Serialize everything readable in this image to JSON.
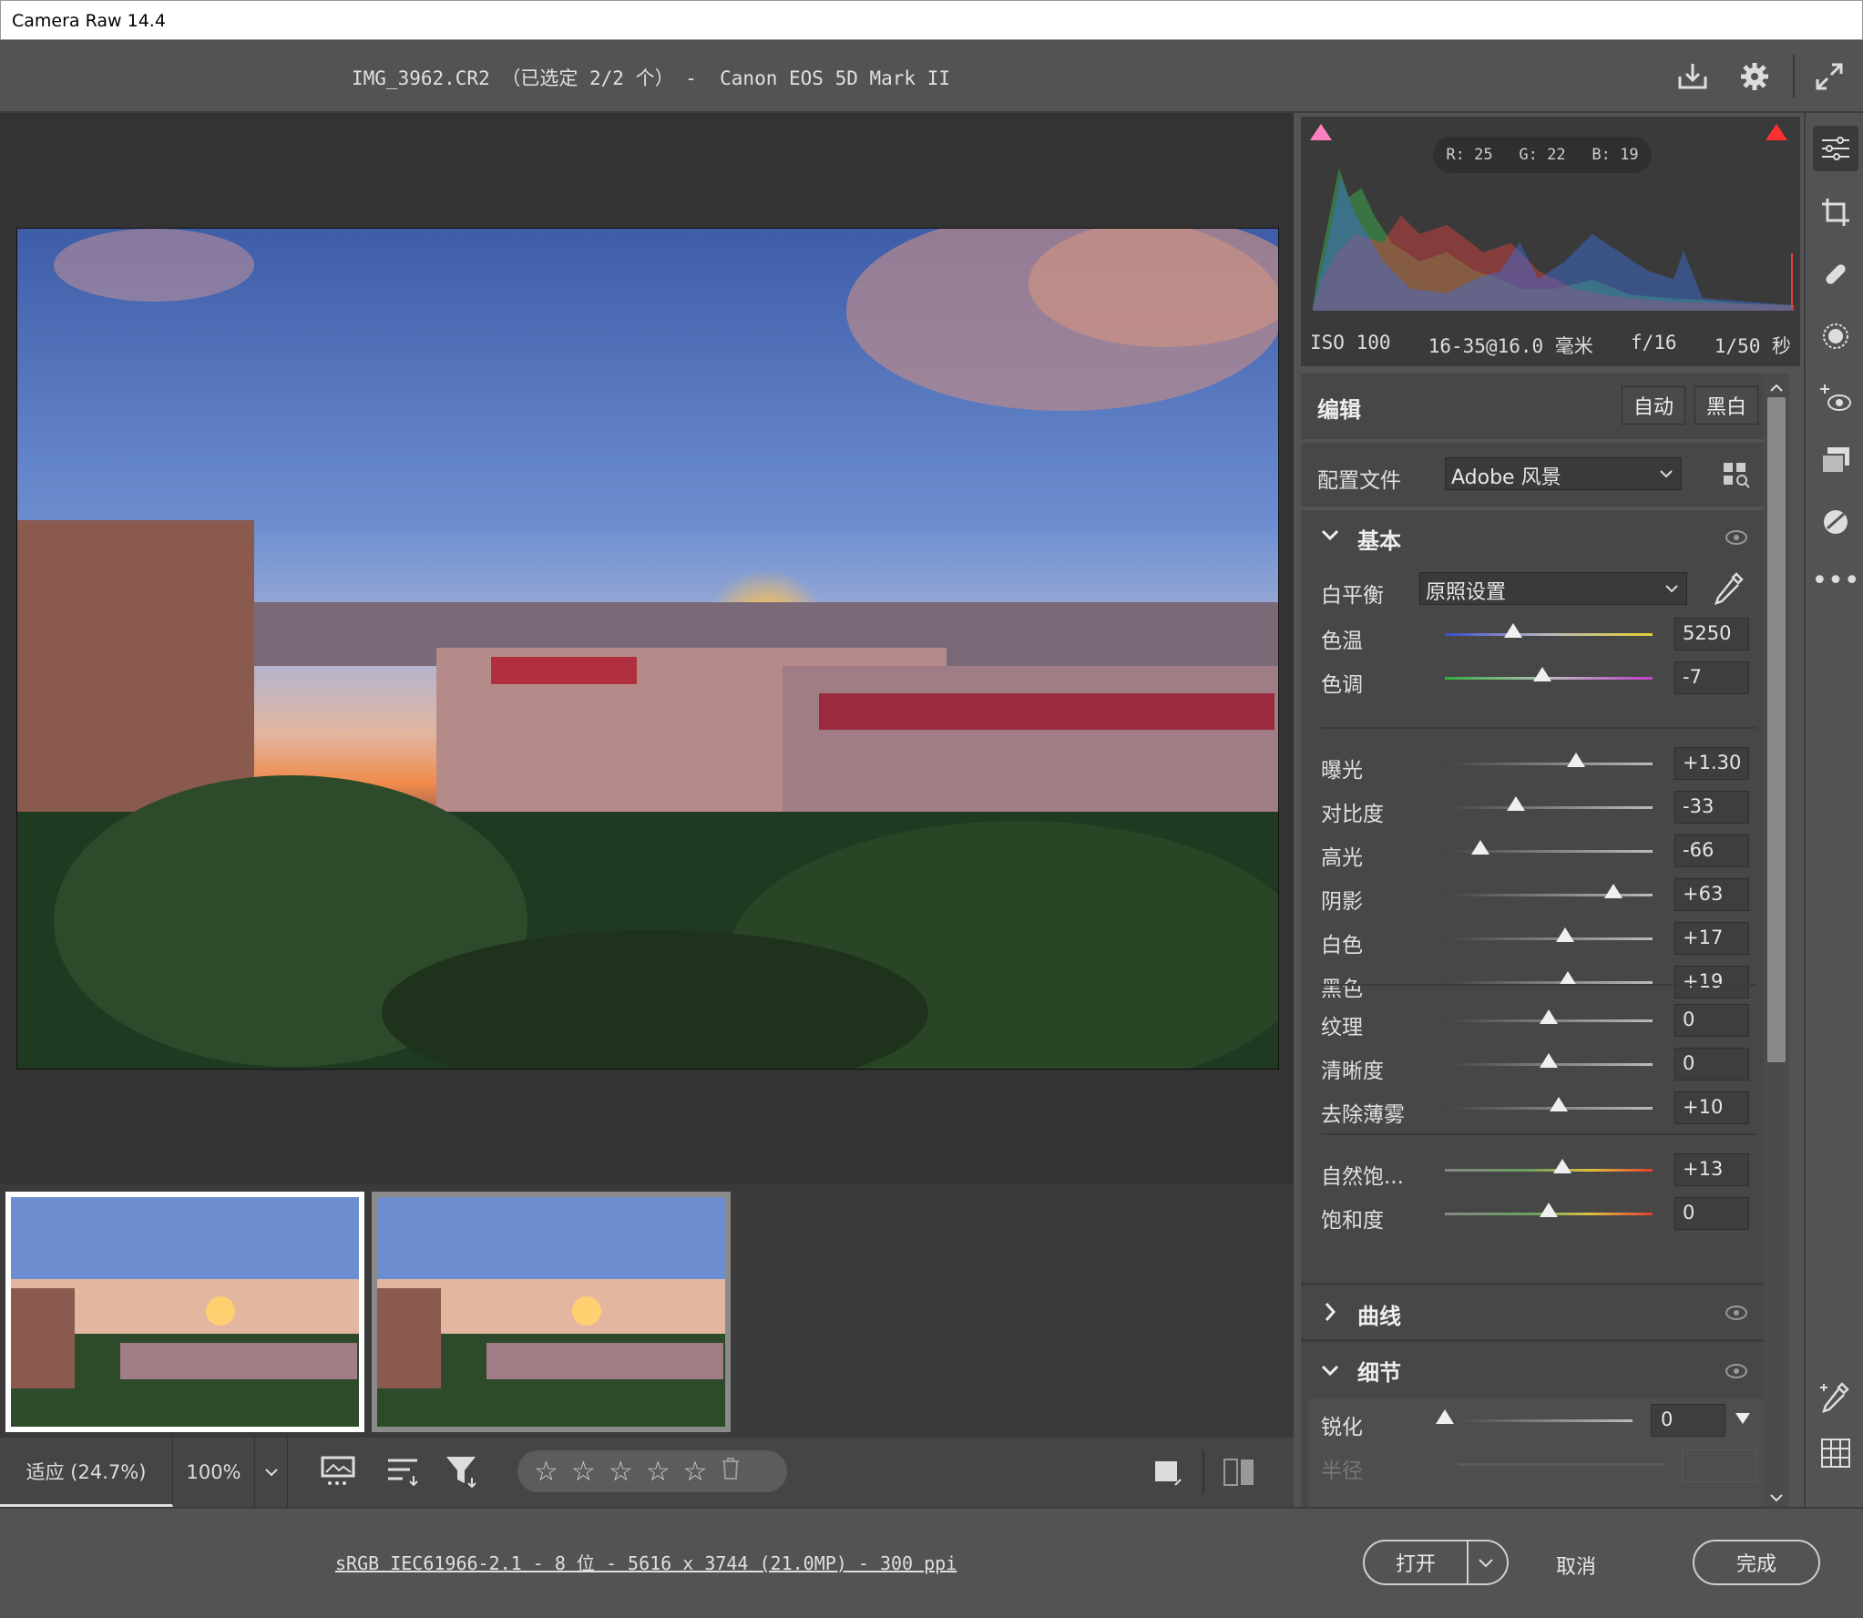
{
  "window": {
    "title": "Camera Raw 14.4"
  },
  "header": {
    "file_info": "IMG_3962.CR2 （已选定 2/2 个） -  Canon EOS 5D Mark II",
    "icons": [
      "save-icon",
      "gear-icon",
      "fullscreen-icon"
    ]
  },
  "histogram": {
    "readout": {
      "r": "R: 25",
      "g": "G: 22",
      "b": "B: 19"
    },
    "colors": {
      "red": "#e04040",
      "green": "#3cbc4c",
      "blue": "#3e6fe0",
      "shadow_clip": "#ff80c0",
      "highlight_clip": "#ff3030"
    }
  },
  "exif": {
    "iso": "ISO 100",
    "lens": "16-35@16.0 毫米",
    "aperture": "f/16",
    "shutter": "1/50 秒"
  },
  "edit": {
    "title": "编辑",
    "auto_label": "自动",
    "bw_label": "黑白"
  },
  "profile": {
    "label": "配置文件",
    "value": "Adobe 风景"
  },
  "basic": {
    "title": "基本",
    "wb_label": "白平衡",
    "wb_value": "原照设置",
    "sliders_wb": [
      {
        "label": "色温",
        "value": "5250",
        "pos": 0.33
      },
      {
        "label": "色调",
        "value": "-7",
        "pos": 0.47
      }
    ],
    "sliders_tone": [
      {
        "label": "曝光",
        "value": "+1.30",
        "pos": 0.63
      },
      {
        "label": "对比度",
        "value": "-33",
        "pos": 0.34
      },
      {
        "label": "高光",
        "value": "-66",
        "pos": 0.17
      },
      {
        "label": "阴影",
        "value": "+63",
        "pos": 0.81
      },
      {
        "label": "白色",
        "value": "+17",
        "pos": 0.58
      },
      {
        "label": "黑色",
        "value": "+19",
        "pos": 0.59
      }
    ],
    "sliders_presence": [
      {
        "label": "纹理",
        "value": "0",
        "pos": 0.5
      },
      {
        "label": "清晰度",
        "value": "0",
        "pos": 0.5
      },
      {
        "label": "去除薄雾",
        "value": "+10",
        "pos": 0.55
      }
    ],
    "sliders_color": [
      {
        "label": "自然饱...",
        "value": "+13",
        "pos": 0.565
      },
      {
        "label": "饱和度",
        "value": "0",
        "pos": 0.5
      }
    ]
  },
  "curves": {
    "title": "曲线"
  },
  "detail": {
    "title": "细节",
    "sharpen_label": "锐化",
    "sharpen_value": "0",
    "radius_label": "半径"
  },
  "bottom_tools": {
    "zoom_fit": "适应 (24.7%)",
    "zoom_100": "100%",
    "stars": [
      "☆",
      "☆",
      "☆",
      "☆",
      "☆"
    ]
  },
  "footer": {
    "color_info": "sRGB IEC61966-2.1 - 8 位 - 5616 x 3744 (21.0MP) - 300 ppi",
    "open_label": "打开",
    "cancel_label": "取消",
    "done_label": "完成"
  }
}
